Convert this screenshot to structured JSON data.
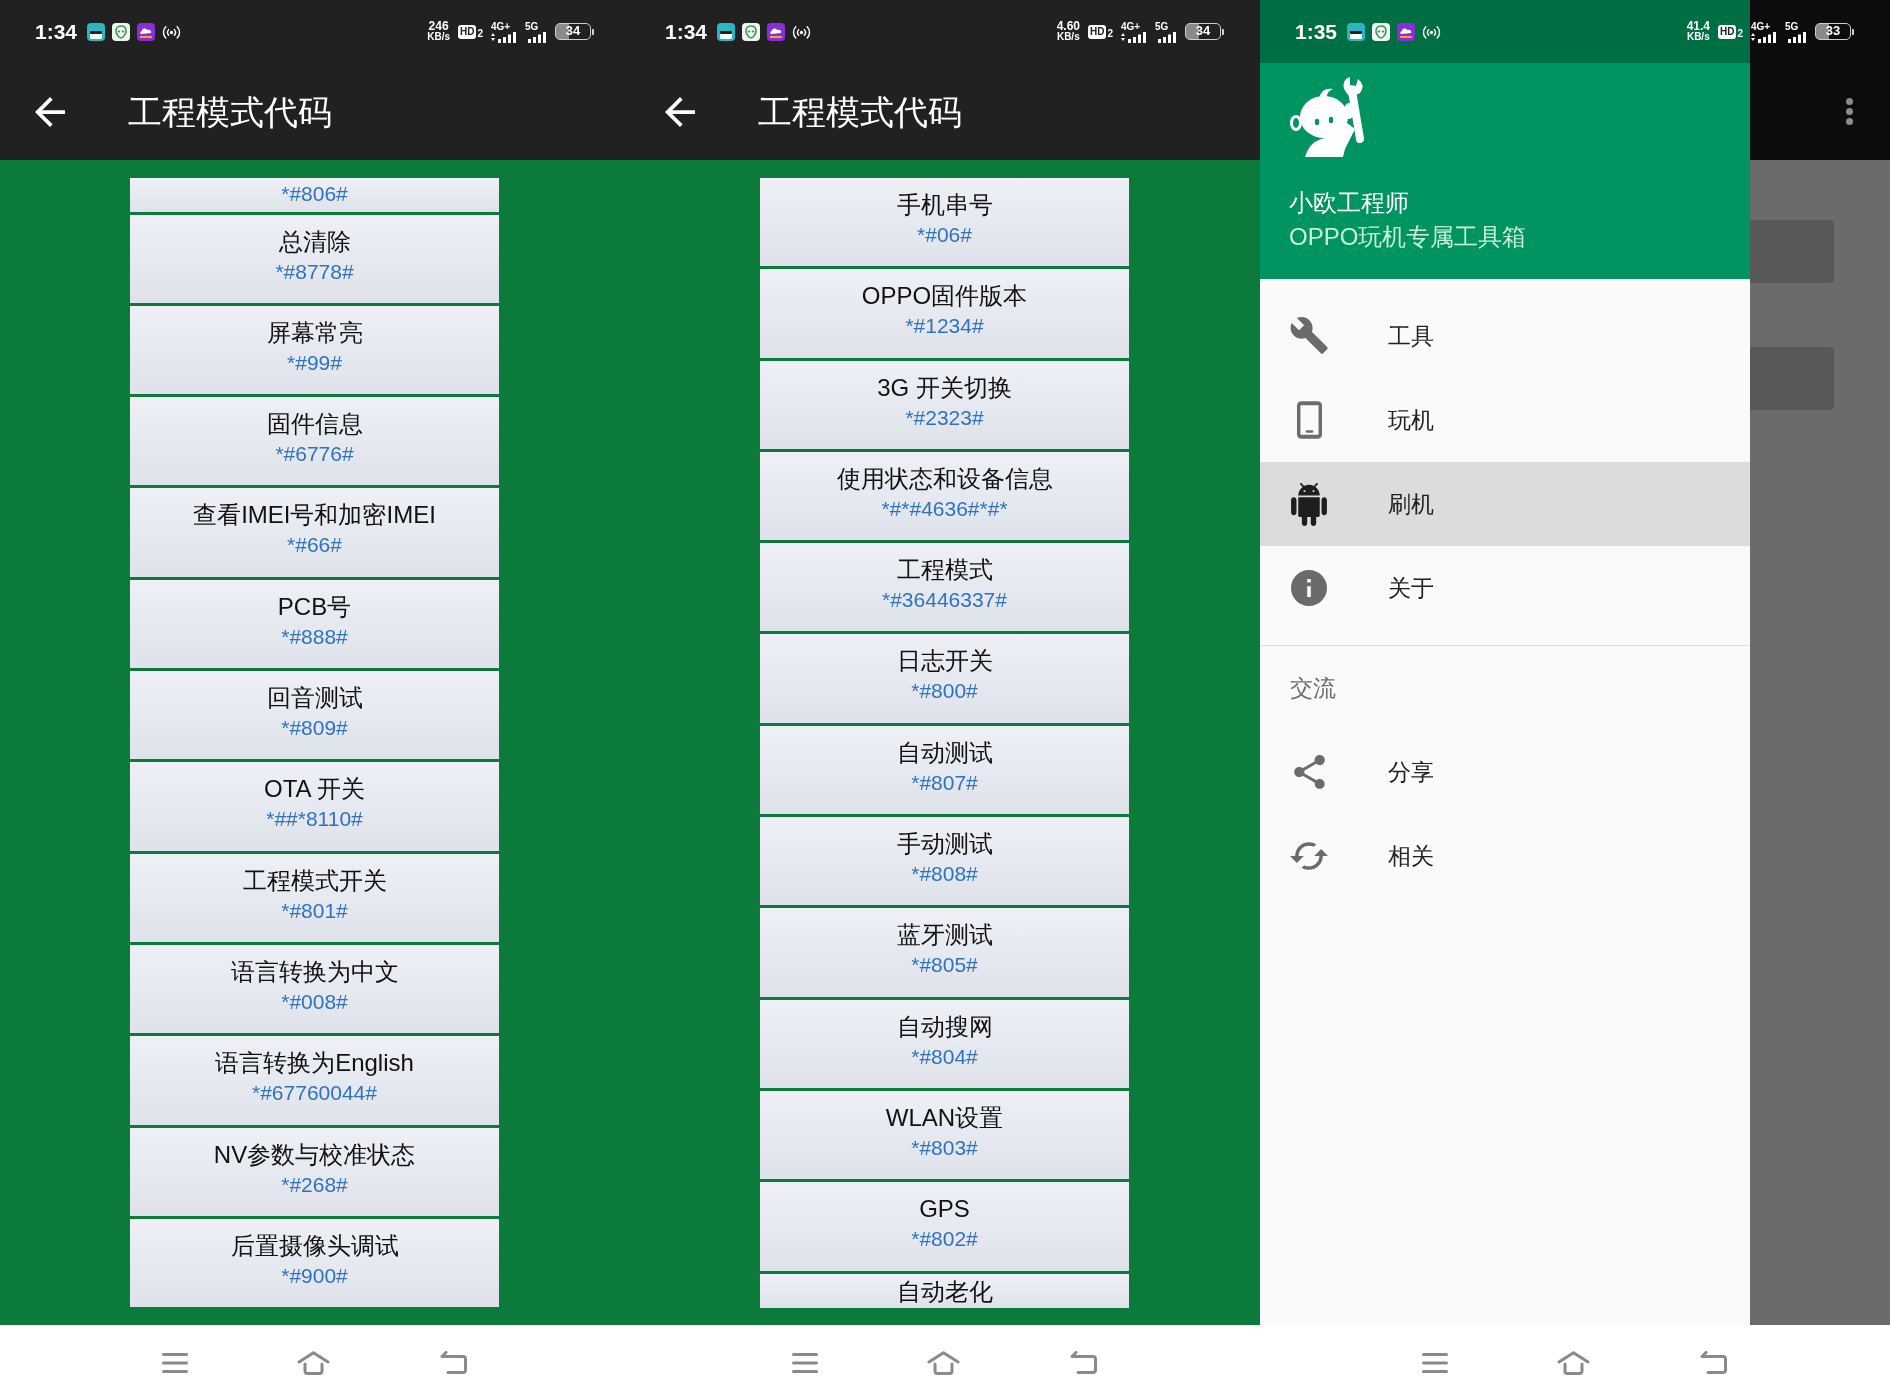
{
  "code_screens": [
    {
      "status_bar": {
        "time": "1:34",
        "speed": "246",
        "speed_unit": "KB/s",
        "hd": "HD",
        "hd_index": "2",
        "cell_1": "4G+",
        "cell_2": "5G",
        "battery": "34"
      },
      "app_bar": {
        "title": "工程模式代码"
      },
      "codes": [
        {
          "kind": "cut_top",
          "code": "*#806#"
        },
        {
          "kind": "full",
          "title": "总清除",
          "code": "*#8778#"
        },
        {
          "kind": "full",
          "title": "屏幕常亮",
          "code": "*#99#"
        },
        {
          "kind": "full",
          "title": "固件信息",
          "code": "*#6776#"
        },
        {
          "kind": "full",
          "title": "查看IMEI号和加密IMEI",
          "code": "*#66#"
        },
        {
          "kind": "full",
          "title": "PCB号",
          "code": "*#888#"
        },
        {
          "kind": "full",
          "title": "回音测试",
          "code": "*#809#"
        },
        {
          "kind": "full",
          "title": "OTA 开关",
          "code": "*##*8110#"
        },
        {
          "kind": "full",
          "title": "工程模式开关",
          "code": "*#801#"
        },
        {
          "kind": "full",
          "title": "语言转换为中文",
          "code": "*#008#"
        },
        {
          "kind": "full",
          "title": "语言转换为English",
          "code": "*#67760044#"
        },
        {
          "kind": "full",
          "title": "NV参数与校准状态",
          "code": "*#268#"
        },
        {
          "kind": "full",
          "title": "后置摄像头调试",
          "code": "*#900#"
        }
      ]
    },
    {
      "status_bar": {
        "time": "1:34",
        "speed": "4.60",
        "speed_unit": "KB/s",
        "hd": "HD",
        "hd_index": "2",
        "cell_1": "4G+",
        "cell_2": "5G",
        "battery": "34"
      },
      "app_bar": {
        "title": "工程模式代码"
      },
      "codes": [
        {
          "kind": "full",
          "title": "手机串号",
          "code": "*#06#"
        },
        {
          "kind": "full",
          "title": "OPPO固件版本",
          "code": "*#1234#"
        },
        {
          "kind": "full",
          "title": "3G 开关切换",
          "code": "*#2323#"
        },
        {
          "kind": "full",
          "title": "使用状态和设备信息",
          "code": "*#*#4636#*#*"
        },
        {
          "kind": "full",
          "title": "工程模式",
          "code": "*#36446337#"
        },
        {
          "kind": "full",
          "title": "日志开关",
          "code": "*#800#"
        },
        {
          "kind": "full",
          "title": "自动测试",
          "code": "*#807#"
        },
        {
          "kind": "full",
          "title": "手动测试",
          "code": "*#808#"
        },
        {
          "kind": "full",
          "title": "蓝牙测试",
          "code": "*#805#"
        },
        {
          "kind": "full",
          "title": "自动搜网",
          "code": "*#804#"
        },
        {
          "kind": "full",
          "title": "WLAN设置",
          "code": "*#803#"
        },
        {
          "kind": "full",
          "title": "GPS",
          "code": "*#802#"
        },
        {
          "kind": "cut_bottom",
          "title": "自动老化"
        }
      ]
    }
  ],
  "drawer_screen": {
    "status_bar": {
      "time": "1:35",
      "speed": "41.4",
      "speed_unit": "KB/s",
      "hd": "HD",
      "hd_index": "2",
      "cell_1": "4G+",
      "cell_2": "5G",
      "battery": "33"
    },
    "drawer": {
      "title": "小欧工程师",
      "subtitle": "OPPO玩机专属工具箱",
      "sections": [
        {
          "items": [
            {
              "label": "工具",
              "selected": false
            },
            {
              "label": "玩机",
              "selected": false
            },
            {
              "label": "刷机",
              "selected": true
            },
            {
              "label": "关于",
              "selected": false
            }
          ]
        },
        {
          "header": "交流",
          "items": [
            {
              "label": "分享",
              "selected": false
            },
            {
              "label": "相关",
              "selected": false
            }
          ]
        }
      ]
    }
  }
}
